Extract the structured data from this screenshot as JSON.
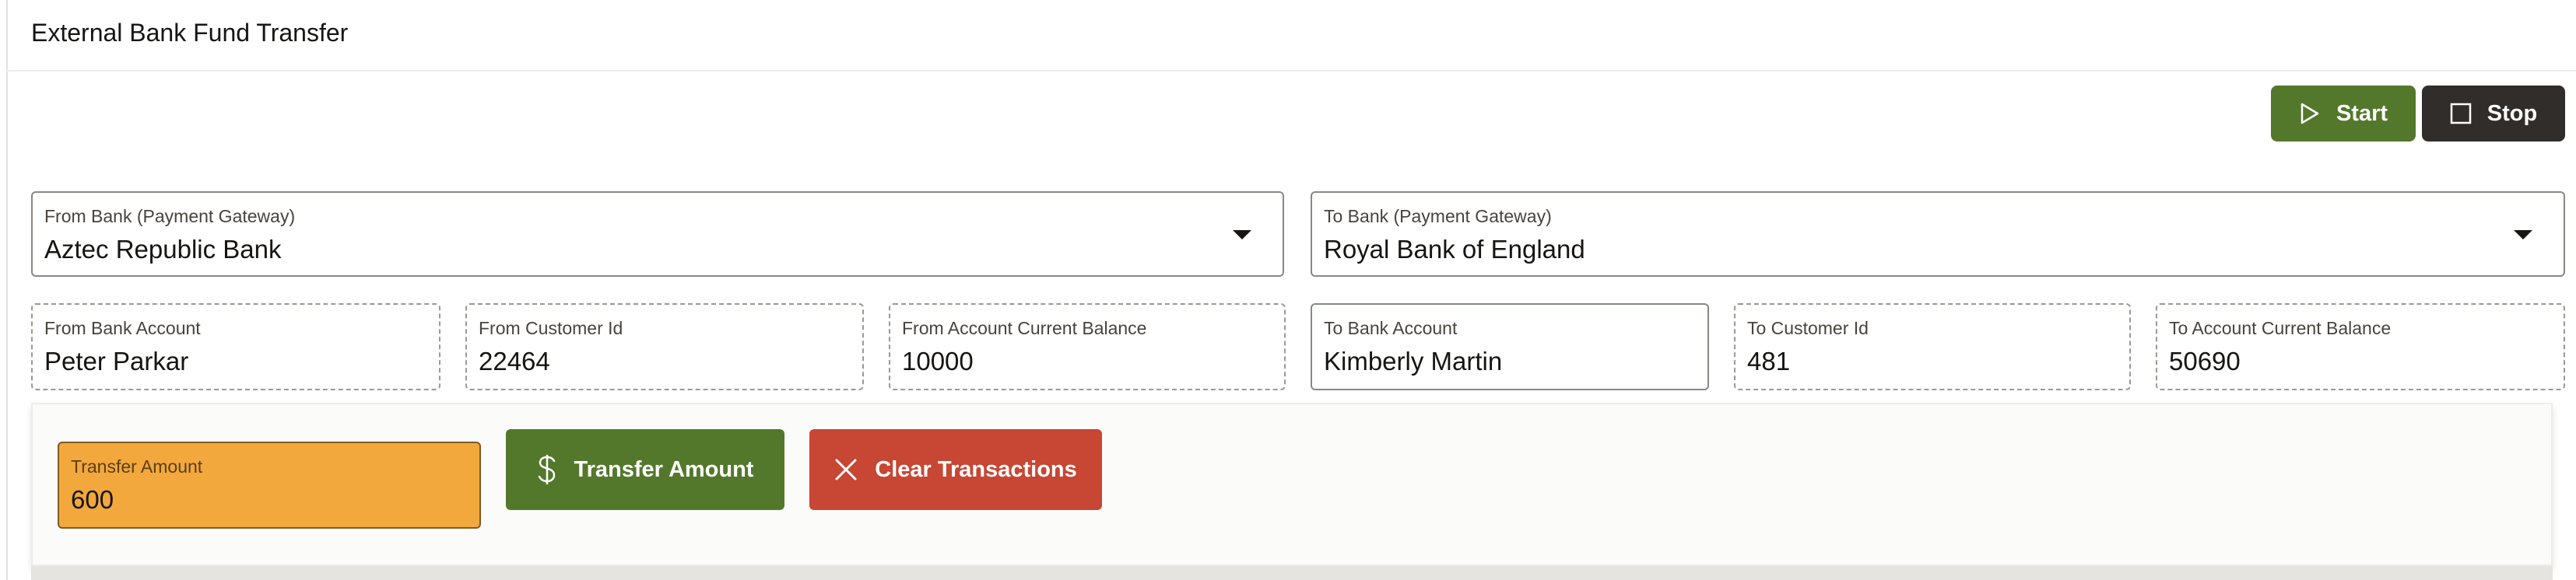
{
  "header": {
    "title": "External Bank Fund Transfer"
  },
  "toolbar": {
    "start_label": "Start",
    "stop_label": "Stop"
  },
  "from_bank": {
    "label": "From Bank (Payment Gateway)",
    "value": "Aztec Republic Bank"
  },
  "to_bank": {
    "label": "To Bank (Payment Gateway)",
    "value": "Royal Bank of England"
  },
  "from_account": {
    "label": "From Bank Account",
    "value": "Peter Parkar"
  },
  "from_customer": {
    "label": "From Customer Id",
    "value": "22464"
  },
  "from_balance": {
    "label": "From Account Current Balance",
    "value": "10000"
  },
  "to_account": {
    "label": "To Bank Account",
    "value": "Kimberly Martin"
  },
  "to_customer": {
    "label": "To Customer Id",
    "value": "481"
  },
  "to_balance": {
    "label": "To Account Current Balance",
    "value": "50690"
  },
  "transfer": {
    "amount_label": "Transfer Amount",
    "amount_value": "600",
    "transfer_button": "Transfer Amount",
    "clear_button": "Clear Transactions"
  },
  "icons": {
    "start": "play-icon",
    "stop": "stop-square-icon",
    "transfer": "dollar-icon",
    "clear": "close-icon",
    "dropdown": "caret-down-icon"
  },
  "colors": {
    "primary_green": "#53782b",
    "dark": "#312d2a",
    "danger": "#c74634",
    "amount_highlight": "#f2a83d"
  }
}
